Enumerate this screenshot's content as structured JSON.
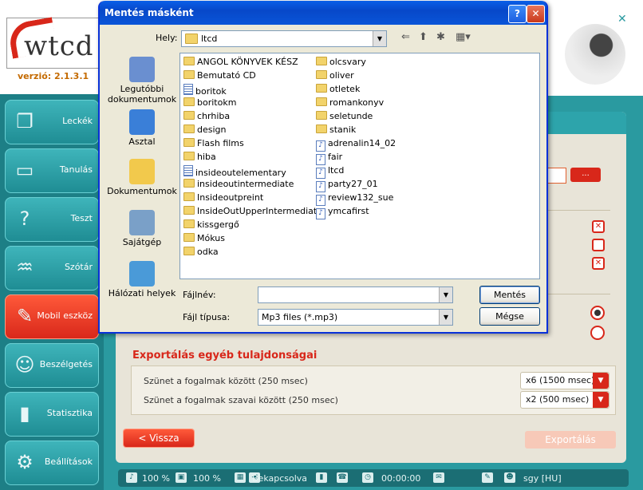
{
  "app": {
    "logo_text": "wtcd",
    "version": "verzió: 2.1.3.1",
    "sidebar": [
      {
        "label": "Leckék",
        "icon": "pages-icon"
      },
      {
        "label": "Tanulás",
        "icon": "whiteboard-icon"
      },
      {
        "label": "Teszt",
        "icon": "question-icon"
      },
      {
        "label": "Szótár",
        "icon": "book-icon"
      },
      {
        "label": "Mobil eszköz",
        "icon": "mobile-device-icon",
        "active": true
      },
      {
        "label": "Beszélgetés",
        "icon": "chat-icon"
      },
      {
        "label": "Statisztika",
        "icon": "bar-chart-icon"
      },
      {
        "label": "Beállítások",
        "icon": "gears-icon"
      }
    ],
    "browse_button": "...",
    "export_section": {
      "title": "Exportálás egyéb tulajdonságai",
      "rows": [
        {
          "label": "Szünet a fogalmak között (250 msec)",
          "value": "x6 (1500 msec)"
        },
        {
          "label": "Szünet a fogalmak szavai között (250 msec)",
          "value": "x2 (500 msec)"
        }
      ]
    },
    "back_button": "< Vissza",
    "export_button": "Exportálás",
    "statusbar": {
      "music_volume": "100 %",
      "video_volume": "100 %",
      "mode": "Bekapcsolva",
      "time": "00:00:00",
      "user": "sgy [HU]"
    },
    "accent_color": "#d8271a",
    "teal_color": "#2a9aa0"
  },
  "dialog": {
    "title": "Mentés másként",
    "help_button": "?",
    "close_button": "✕",
    "location_label": "Hely:",
    "location_value": "ltcd",
    "places": [
      {
        "label": "Legutóbbi dokumentumok",
        "icon": "recent-documents-icon"
      },
      {
        "label": "Asztal",
        "icon": "desktop-icon"
      },
      {
        "label": "Dokumentumok",
        "icon": "documents-folder-icon"
      },
      {
        "label": "Sajátgép",
        "icon": "my-computer-icon"
      },
      {
        "label": "Hálózati helyek",
        "icon": "network-places-icon"
      }
    ],
    "files_col1": [
      {
        "name": "ANGOL KÖNYVEK KÉSZ",
        "type": "folder"
      },
      {
        "name": "Bemutató CD",
        "type": "folder"
      },
      {
        "name": "boritok",
        "type": "doc"
      },
      {
        "name": "boritokm",
        "type": "folder"
      },
      {
        "name": "chrhiba",
        "type": "folder"
      },
      {
        "name": "design",
        "type": "folder"
      },
      {
        "name": "Flash films",
        "type": "folder"
      },
      {
        "name": "hiba",
        "type": "folder"
      },
      {
        "name": "insideoutelementary",
        "type": "doc"
      },
      {
        "name": "insideoutintermediate",
        "type": "folder"
      },
      {
        "name": "Insideoutpreint",
        "type": "folder"
      },
      {
        "name": "InsideOutUpperIntermediate",
        "type": "folder"
      },
      {
        "name": "kissgergő",
        "type": "folder"
      },
      {
        "name": "Mókus",
        "type": "folder"
      },
      {
        "name": "odka",
        "type": "folder"
      }
    ],
    "files_col2": [
      {
        "name": "olcsvary",
        "type": "folder"
      },
      {
        "name": "oliver",
        "type": "folder"
      },
      {
        "name": "otletek",
        "type": "folder"
      },
      {
        "name": "romankonyv",
        "type": "folder"
      },
      {
        "name": "seletunde",
        "type": "folder"
      },
      {
        "name": "stanik",
        "type": "folder"
      },
      {
        "name": "adrenalin14_02",
        "type": "mp3"
      },
      {
        "name": "fair",
        "type": "mp3"
      },
      {
        "name": "ltcd",
        "type": "mp3"
      },
      {
        "name": "party27_01",
        "type": "mp3"
      },
      {
        "name": "review132_sue",
        "type": "mp3"
      },
      {
        "name": "ymcafirst",
        "type": "mp3"
      }
    ],
    "filename_label": "Fájlnév:",
    "filename_value": "",
    "filetype_label": "Fájl típusa:",
    "filetype_value": "Mp3 files (*.mp3)",
    "save_button": "Mentés",
    "cancel_button": "Mégse"
  }
}
